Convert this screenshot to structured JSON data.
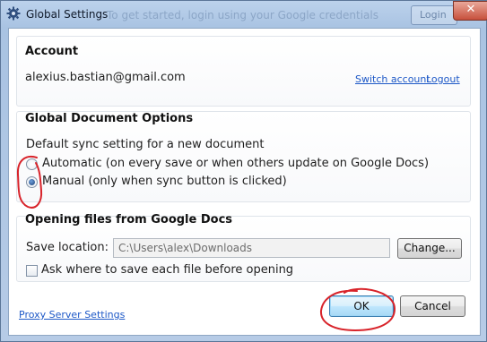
{
  "window": {
    "title": "Global Settings",
    "background_text": "To get started, login using your Google credentials",
    "background_button": "Login",
    "close_glyph": "✕"
  },
  "account": {
    "heading": "Account",
    "email": "alexius.bastian@gmail.com",
    "switch_account": "Switch account",
    "logout": "Logout"
  },
  "document_options": {
    "heading": "Global Document Options",
    "description": "Default sync setting for a new document",
    "options": [
      {
        "label": "Automatic (on every save or when others update on Google Docs)",
        "selected": false
      },
      {
        "label": "Manual (only when sync button is clicked)",
        "selected": true
      }
    ]
  },
  "opening_files": {
    "heading": "Opening files from Google Docs",
    "save_location_label": "Save location:",
    "save_location_value": "C:\\Users\\alex\\Downloads",
    "change_button": "Change...",
    "ask_checkbox_label": "Ask where to save each file before opening",
    "ask_checked": false
  },
  "footer": {
    "proxy_link": "Proxy Server Settings",
    "ok_button": "OK",
    "cancel_button": "Cancel"
  },
  "colors": {
    "annotation": "#d8232a",
    "link": "#1d58c7"
  },
  "icons": {
    "title": "gear-icon",
    "close": "close-icon"
  }
}
